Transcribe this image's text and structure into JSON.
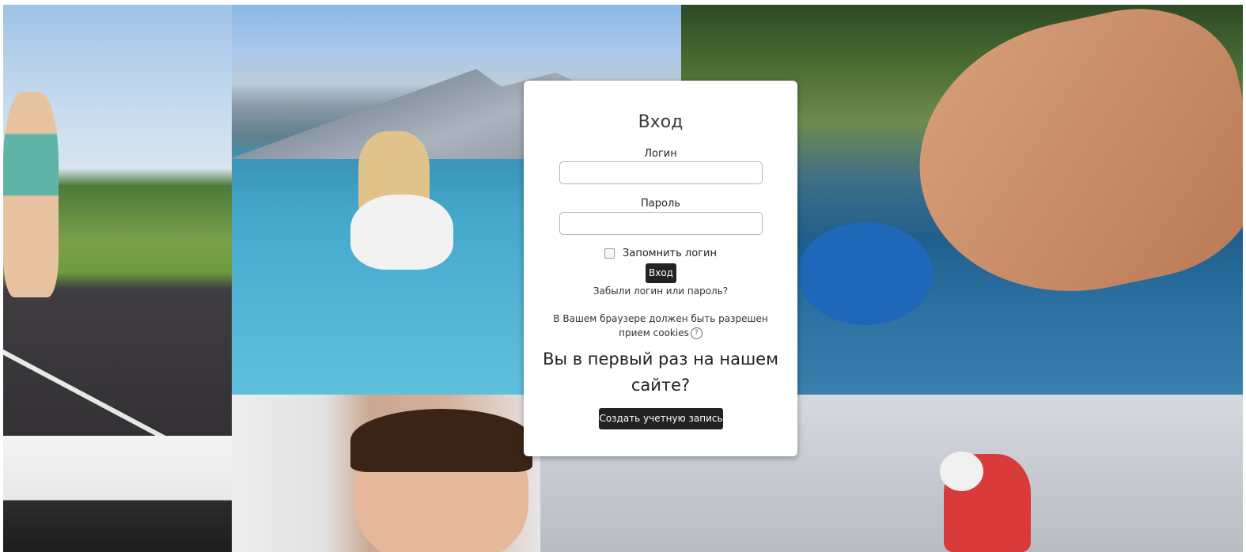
{
  "login": {
    "title": "Вход",
    "username_label": "Логин",
    "username_value": "",
    "password_label": "Пароль",
    "password_value": "",
    "remember_label": "Запомнить логин",
    "remember_checked": false,
    "submit_label": "Вход",
    "forgot_link": "Забыли логин или пароль?",
    "cookies_note": "В Вашем браузере должен быть разрешен прием cookies",
    "help_icon": "question-circle-icon"
  },
  "signup": {
    "heading": "Вы в первый раз на нашем сайте?",
    "button_label": "Создать учетную запись"
  }
}
